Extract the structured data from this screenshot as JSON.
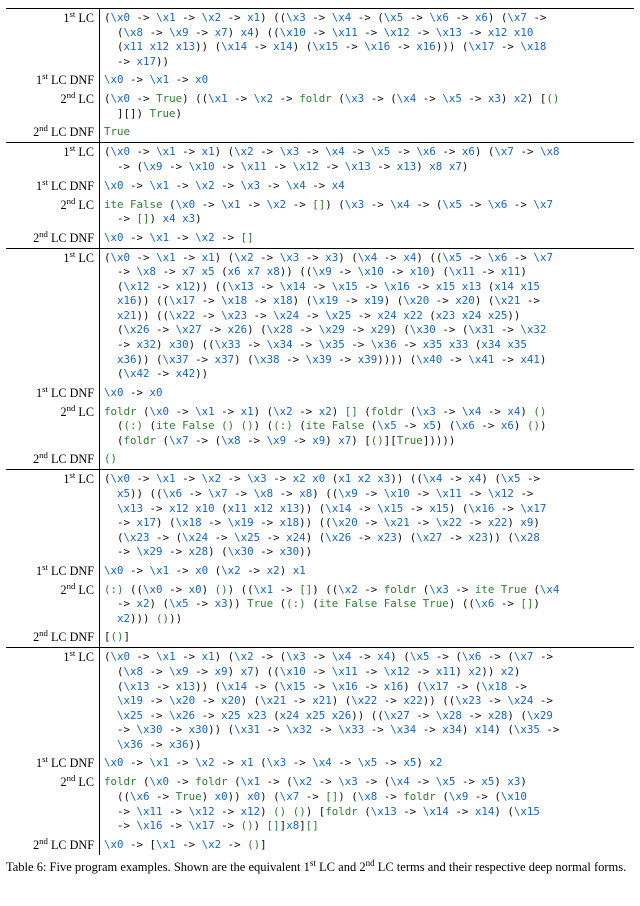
{
  "labels": {
    "lc1": "1<sup>st</sup> LC",
    "lc1dnf": "1<sup>st</sup> LC DNF",
    "lc2": "2<sup>nd</sup> LC",
    "lc2dnf": "2<sup>nd</sup> LC DNF"
  },
  "caption": "Table 6: Five program examples. Shown are the equivalent 1<sup>st</sup> LC and 2<sup>nd</sup> LC terms and their respective deep normal forms.",
  "groups": [
    {
      "rows": [
        {
          "label_key": "lc1",
          "tokens": [
            "(\\",
            "x0",
            " -> \\",
            "x1",
            " -> \\",
            "x2",
            " -> ",
            "x1",
            ") ((\\",
            "x3",
            " -> \\",
            "x4",
            " -> (\\",
            "x5",
            " -> \\",
            "x6",
            " -> ",
            "x6",
            ") (\\",
            "x7",
            " ->\n  (\\",
            "x8",
            " -> \\",
            "x9",
            " -> ",
            "x7",
            ") ",
            "x4",
            ") ((\\",
            "x10",
            " -> \\",
            "x11",
            " -> \\",
            "x12",
            " -> \\",
            "x13",
            " -> ",
            "x12",
            " ",
            "x10",
            "\n  (",
            "x11",
            " ",
            "x12",
            " ",
            "x13",
            ")) (\\",
            "x14",
            " -> ",
            "x14",
            ") (\\",
            "x15",
            " -> \\",
            "x16",
            " -> ",
            "x16",
            "))) (\\",
            "x17",
            " -> \\",
            "x18",
            "\n  -> ",
            "x17",
            "))"
          ]
        },
        {
          "label_key": "lc1dnf",
          "tokens": [
            "\\",
            "x0",
            " -> \\",
            "x1",
            " -> ",
            "x0"
          ]
        },
        {
          "label_key": "lc2",
          "tokens": [
            "(\\",
            "x0",
            " -> ",
            "~True",
            ") ((\\",
            "x1",
            " -> \\",
            "x2",
            " -> ",
            "~foldr",
            " (\\",
            "x3",
            " -> (\\",
            "x4",
            " -> \\",
            "x5",
            " -> ",
            "x3",
            ") ",
            "x2",
            ") [",
            "~()",
            "\n  ][]) ",
            "~True",
            ")"
          ]
        },
        {
          "label_key": "lc2dnf",
          "tokens": [
            "~True"
          ]
        }
      ]
    },
    {
      "rows": [
        {
          "label_key": "lc1",
          "tokens": [
            "(\\",
            "x0",
            " -> \\",
            "x1",
            " -> ",
            "x1",
            ") (\\",
            "x2",
            " -> \\",
            "x3",
            " -> \\",
            "x4",
            " -> \\",
            "x5",
            " -> \\",
            "x6",
            " -> ",
            "x6",
            ") (\\",
            "x7",
            " -> \\",
            "x8",
            "\n  -> (\\",
            "x9",
            " -> \\",
            "x10",
            " -> \\",
            "x11",
            " -> \\",
            "x12",
            " -> \\",
            "x13",
            " -> ",
            "x13",
            ") ",
            "x8",
            " ",
            "x7",
            ")"
          ]
        },
        {
          "label_key": "lc1dnf",
          "tokens": [
            "\\",
            "x0",
            " -> \\",
            "x1",
            " -> \\",
            "x2",
            " -> \\",
            "x3",
            " -> \\",
            "x4",
            " -> ",
            "x4"
          ]
        },
        {
          "label_key": "lc2",
          "tokens": [
            "~ite",
            " ",
            "~False",
            " (\\",
            "x0",
            " -> \\",
            "x1",
            " -> \\",
            "x2",
            " -> ",
            "~[]",
            ") (\\",
            "x3",
            " -> \\",
            "x4",
            " -> (\\",
            "x5",
            " -> \\",
            "x6",
            " -> \\",
            "x7",
            "\n  -> ",
            "~[]",
            ") ",
            "x4",
            " ",
            "x3",
            ")"
          ]
        },
        {
          "label_key": "lc2dnf",
          "tokens": [
            "\\",
            "x0",
            " -> \\",
            "x1",
            " -> \\",
            "x2",
            " -> ",
            "~[]"
          ]
        }
      ]
    },
    {
      "rows": [
        {
          "label_key": "lc1",
          "tokens": [
            "(\\",
            "x0",
            " -> \\",
            "x1",
            " -> ",
            "x1",
            ") (\\",
            "x2",
            " -> \\",
            "x3",
            " -> ",
            "x3",
            ") (\\",
            "x4",
            " -> ",
            "x4",
            ") ((\\",
            "x5",
            " -> \\",
            "x6",
            " -> \\",
            "x7",
            "\n  -> \\",
            "x8",
            " -> ",
            "x7",
            " ",
            "x5",
            " (",
            "x6",
            " ",
            "x7",
            " ",
            "x8",
            ")) ((\\",
            "x9",
            " -> \\",
            "x10",
            " -> ",
            "x10",
            ") (\\",
            "x11",
            " -> ",
            "x11",
            ")\n  (\\",
            "x12",
            " -> ",
            "x12",
            ")) ((\\",
            "x13",
            " -> \\",
            "x14",
            " -> \\",
            "x15",
            " -> \\",
            "x16",
            " -> ",
            "x15",
            " ",
            "x13",
            " (",
            "x14",
            " ",
            "x15",
            "\n  ",
            "x16",
            ")) ((\\",
            "x17",
            " -> \\",
            "x18",
            " -> ",
            "x18",
            ") (\\",
            "x19",
            " -> ",
            "x19",
            ") (\\",
            "x20",
            " -> ",
            "x20",
            ") (\\",
            "x21",
            " ->\n  ",
            "x21",
            ")) ((\\",
            "x22",
            " -> \\",
            "x23",
            " -> \\",
            "x24",
            " -> \\",
            "x25",
            " -> ",
            "x24",
            " ",
            "x22",
            " (",
            "x23",
            " ",
            "x24",
            " ",
            "x25",
            "))\n  (\\",
            "x26",
            " -> \\",
            "x27",
            " -> ",
            "x26",
            ") (\\",
            "x28",
            " -> \\",
            "x29",
            " -> ",
            "x29",
            ") (\\",
            "x30",
            " -> (\\",
            "x31",
            " -> \\",
            "x32",
            "\n  -> ",
            "x32",
            ") ",
            "x30",
            ") ((\\",
            "x33",
            " -> \\",
            "x34",
            " -> \\",
            "x35",
            " -> \\",
            "x36",
            " -> ",
            "x35",
            " ",
            "x33",
            " (",
            "x34",
            " ",
            "x35",
            "\n  ",
            "x36",
            ")) (\\",
            "x37",
            " -> ",
            "x37",
            ") (\\",
            "x38",
            " -> \\",
            "x39",
            " -> ",
            "x39",
            ")))) (\\",
            "x40",
            " -> \\",
            "x41",
            " -> ",
            "x41",
            ")\n  (\\",
            "x42",
            " -> ",
            "x42",
            "))"
          ]
        },
        {
          "label_key": "lc1dnf",
          "tokens": [
            "\\",
            "x0",
            " -> ",
            "x0"
          ]
        },
        {
          "label_key": "lc2",
          "tokens": [
            "~foldr",
            " (\\",
            "x0",
            " -> \\",
            "x1",
            " -> ",
            "x1",
            ") (\\",
            "x2",
            " -> ",
            "x2",
            ") ",
            "~[]",
            " (",
            "~foldr",
            " (\\",
            "x3",
            " -> \\",
            "x4",
            " -> ",
            "x4",
            ") ",
            "~()",
            "\n  (",
            "~(:)",
            " (",
            "~ite",
            " ",
            "~False",
            " ",
            "~()",
            " ",
            "~()",
            ") (",
            "~(:)",
            " (",
            "~ite",
            " ",
            "~False",
            " (\\",
            "x5",
            " -> ",
            "x5",
            ") (\\",
            "x6",
            " -> ",
            "x6",
            ") ",
            "~()",
            ")\n  (",
            "~foldr",
            " (\\",
            "x7",
            " -> (\\",
            "x8",
            " -> \\",
            "x9",
            " -> ",
            "x9",
            ") ",
            "x7",
            ") [",
            "~()",
            "][",
            "~True",
            "]))))"
          ]
        },
        {
          "label_key": "lc2dnf",
          "tokens": [
            "~()"
          ]
        }
      ]
    },
    {
      "rows": [
        {
          "label_key": "lc1",
          "tokens": [
            "(\\",
            "x0",
            " -> \\",
            "x1",
            " -> \\",
            "x2",
            " -> \\",
            "x3",
            " -> ",
            "x2",
            " ",
            "x0",
            " (",
            "x1",
            " ",
            "x2",
            " ",
            "x3",
            ")) ((\\",
            "x4",
            " -> ",
            "x4",
            ") (\\",
            "x5",
            " ->\n  ",
            "x5",
            ")) ((\\",
            "x6",
            " -> \\",
            "x7",
            " -> \\",
            "x8",
            " -> ",
            "x8",
            ") ((\\",
            "x9",
            " -> \\",
            "x10",
            " -> \\",
            "x11",
            " -> \\",
            "x12",
            " ->\n  \\",
            "x13",
            " -> ",
            "x12",
            " ",
            "x10",
            " (",
            "x11",
            " ",
            "x12",
            " ",
            "x13",
            ")) (\\",
            "x14",
            " -> \\",
            "x15",
            " -> ",
            "x15",
            ") (\\",
            "x16",
            " -> \\",
            "x17",
            "\n  -> ",
            "x17",
            ") (\\",
            "x18",
            " -> \\",
            "x19",
            " -> ",
            "x18",
            ")) ((\\",
            "x20",
            " -> \\",
            "x21",
            " -> \\",
            "x22",
            " -> ",
            "x22",
            ") ",
            "x9",
            ")\n  (\\",
            "x23",
            " -> (\\",
            "x24",
            " -> \\",
            "x25",
            " -> ",
            "x24",
            ") (\\",
            "x26",
            " -> ",
            "x23",
            ") (\\",
            "x27",
            " -> ",
            "x23",
            ")) (\\",
            "x28",
            "\n  -> \\",
            "x29",
            " -> ",
            "x28",
            ") (\\",
            "x30",
            " -> ",
            "x30",
            "))"
          ]
        },
        {
          "label_key": "lc1dnf",
          "tokens": [
            "\\",
            "x0",
            " -> \\",
            "x1",
            " -> ",
            "x0",
            " (\\",
            "x2",
            " -> ",
            "x2",
            ") ",
            "x1"
          ]
        },
        {
          "label_key": "lc2",
          "tokens": [
            "~(:)",
            " ((\\",
            "x0",
            " -> ",
            "x0",
            ") ",
            "~()",
            ") ((\\",
            "x1",
            " -> ",
            "~[]",
            ") ((\\",
            "x2",
            " -> ",
            "~foldr",
            " (\\",
            "x3",
            " -> ",
            "~ite",
            " ",
            "~True",
            " (\\",
            "x4",
            "\n  -> ",
            "x2",
            ") (\\",
            "x5",
            " -> ",
            "x3",
            ")) ",
            "~True",
            " (",
            "~(:)",
            " (",
            "~ite",
            " ",
            "~False",
            " ",
            "~False",
            " ",
            "~True",
            ") ((\\",
            "x6",
            " -> ",
            "~[]",
            ")\n  ",
            "x2",
            "))) ",
            "~()",
            "))"
          ]
        },
        {
          "label_key": "lc2dnf",
          "tokens": [
            "[",
            "~()",
            "]"
          ]
        }
      ]
    },
    {
      "rows": [
        {
          "label_key": "lc1",
          "tokens": [
            "(\\",
            "x0",
            " -> \\",
            "x1",
            " -> ",
            "x1",
            ") (\\",
            "x2",
            " -> (\\",
            "x3",
            " -> \\",
            "x4",
            " -> ",
            "x4",
            ") (\\",
            "x5",
            " -> (\\",
            "x6",
            " -> (\\",
            "x7",
            " ->\n  (\\",
            "x8",
            " -> \\",
            "x9",
            " -> ",
            "x9",
            ") ",
            "x7",
            ") ((\\",
            "x10",
            " -> \\",
            "x11",
            " -> \\",
            "x12",
            " -> ",
            "x11",
            ") ",
            "x2",
            ")) ",
            "x2",
            ")\n  (\\",
            "x13",
            " -> ",
            "x13",
            ")) (\\",
            "x14",
            " -> (\\",
            "x15",
            " -> \\",
            "x16",
            " -> ",
            "x16",
            ") (\\",
            "x17",
            " -> (\\",
            "x18",
            " ->\n  \\",
            "x19",
            " -> \\",
            "x20",
            " -> ",
            "x20",
            ") (\\",
            "x21",
            " -> ",
            "x21",
            ") (\\",
            "x22",
            " -> ",
            "x22",
            ")) ((\\",
            "x23",
            " -> \\",
            "x24",
            " ->\n  \\",
            "x25",
            " -> \\",
            "x26",
            " -> ",
            "x25",
            " ",
            "x23",
            " (",
            "x24",
            " ",
            "x25",
            " ",
            "x26",
            ")) ((\\",
            "x27",
            " -> \\",
            "x28",
            " -> ",
            "x28",
            ") (\\",
            "x29",
            "\n  -> \\",
            "x30",
            " -> ",
            "x30",
            ")) (\\",
            "x31",
            " -> \\",
            "x32",
            " -> \\",
            "x33",
            " -> \\",
            "x34",
            " -> ",
            "x34",
            ") ",
            "x14",
            ") (\\",
            "x35",
            " ->\n  \\",
            "x36",
            " -> ",
            "x36",
            "))"
          ]
        },
        {
          "label_key": "lc1dnf",
          "tokens": [
            "\\",
            "x0",
            " -> \\",
            "x1",
            " -> \\",
            "x2",
            " -> ",
            "x1",
            " (\\",
            "x3",
            " -> \\",
            "x4",
            " -> \\",
            "x5",
            " -> ",
            "x5",
            ") ",
            "x2"
          ]
        },
        {
          "label_key": "lc2",
          "tokens": [
            "~foldr",
            " (\\",
            "x0",
            " -> ",
            "~foldr",
            " (\\",
            "x1",
            " -> (\\",
            "x2",
            " -> \\",
            "x3",
            " -> (\\",
            "x4",
            " -> \\",
            "x5",
            " -> ",
            "x5",
            ") ",
            "x3",
            ")\n  ((\\",
            "x6",
            " -> ",
            "~True",
            ") ",
            "x0",
            ")) ",
            "x0",
            ") (\\",
            "x7",
            " -> ",
            "~[]",
            ") (\\",
            "x8",
            " -> ",
            "~foldr",
            " (\\",
            "x9",
            " -> (\\",
            "x10",
            "\n  -> \\",
            "x11",
            " -> \\",
            "x12",
            " -> ",
            "x12",
            ") ",
            "~()",
            " ",
            "~()",
            ") [",
            "~foldr",
            " (\\",
            "x13",
            " -> \\",
            "x14",
            " -> ",
            "x14",
            ") (\\",
            "x15",
            "\n  -> \\",
            "x16",
            " -> \\",
            "x17",
            " -> ",
            "~()",
            ") ",
            "~[]",
            "]",
            "x8",
            "]",
            "~[]"
          ]
        },
        {
          "label_key": "lc2dnf",
          "tokens": [
            "\\",
            "x0",
            " -> [\\",
            "x1",
            " -> \\",
            "x2",
            " -> ",
            "~()",
            "]"
          ]
        }
      ]
    }
  ]
}
